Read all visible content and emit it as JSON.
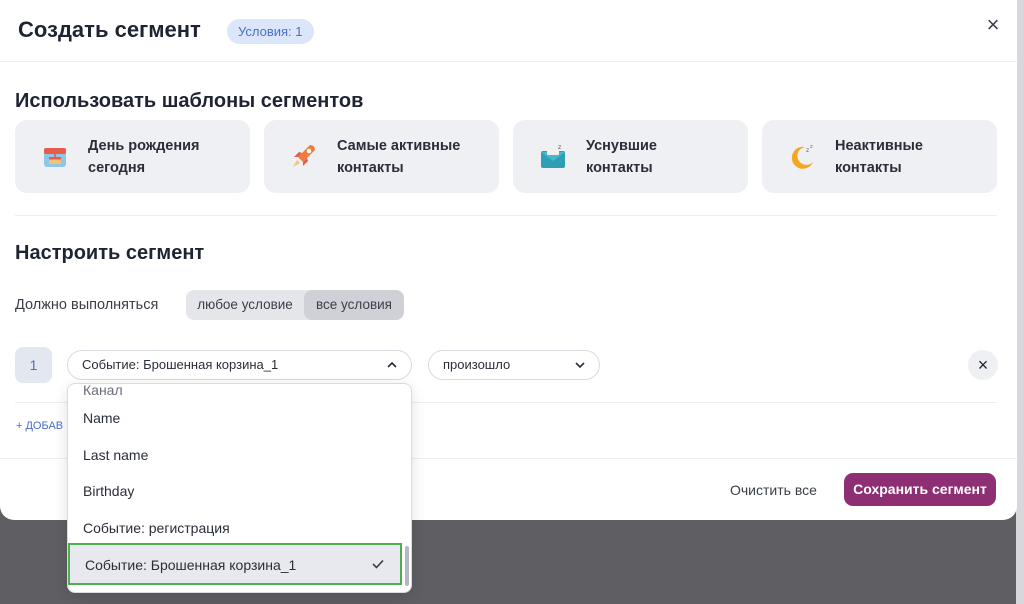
{
  "modal": {
    "title": "Создать сегмент",
    "badge": "Условия: 1"
  },
  "templates": {
    "title": "Использовать шаблоны сегментов",
    "cards": [
      {
        "label": "День рождения\nсегодня",
        "icon": "birthday-cake-icon"
      },
      {
        "label": "Самые активные\nконтакты",
        "icon": "rocket-icon"
      },
      {
        "label": "Уснувшие\nконтакты",
        "icon": "sleeping-envelope-icon"
      },
      {
        "label": "Неактивные\nконтакты",
        "icon": "moon-icon"
      }
    ]
  },
  "configure": {
    "title": "Настроить сегмент",
    "must_label": "Должно выполняться",
    "toggle": {
      "any": "любое условие",
      "all": "все условия",
      "selected": "all"
    }
  },
  "condition": {
    "number": "1",
    "event_select": "Событие: Брошенная корзина_1",
    "happened_select": "произошло"
  },
  "dropdown": {
    "partial_item": "Канал",
    "items": [
      "Name",
      "Last name",
      "Birthday",
      "Событие: регистрация",
      "Событие: Брошенная корзина_1"
    ],
    "selected": "Событие: Брошенная корзина_1"
  },
  "add_condition": "+ ДОБАВ",
  "footer": {
    "clear": "Очистить все",
    "save": "Сохранить сегмент"
  },
  "colors": {
    "accent": "#8f2f73",
    "badge_bg": "#dce6fb",
    "link": "#4a6fc7",
    "highlight": "#4caf50"
  }
}
